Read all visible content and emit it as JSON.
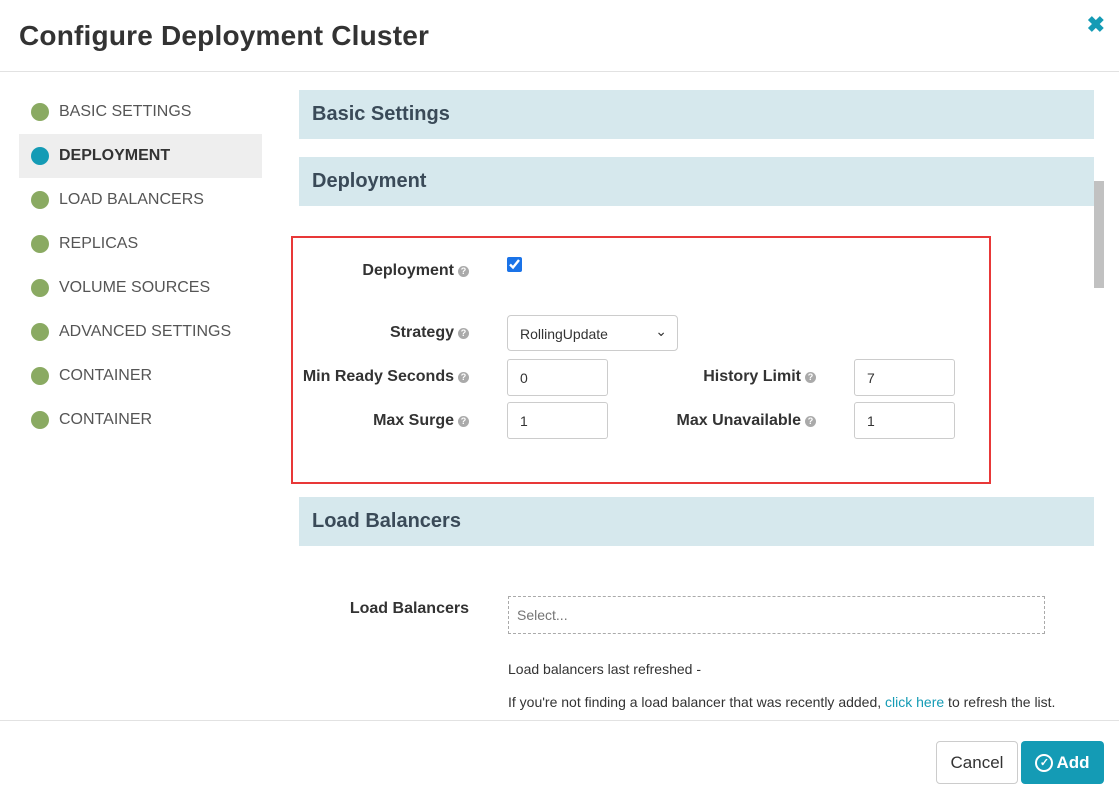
{
  "dialog": {
    "title": "Configure Deployment Cluster",
    "close_icon": "close-icon"
  },
  "sidebar": {
    "items": [
      {
        "label": "BASIC SETTINGS",
        "active": false
      },
      {
        "label": "DEPLOYMENT",
        "active": true
      },
      {
        "label": "LOAD BALANCERS",
        "active": false
      },
      {
        "label": "REPLICAS",
        "active": false
      },
      {
        "label": "VOLUME SOURCES",
        "active": false
      },
      {
        "label": "ADVANCED SETTINGS",
        "active": false
      },
      {
        "label": "CONTAINER",
        "active": false
      },
      {
        "label": "CONTAINER",
        "active": false
      }
    ]
  },
  "sections": {
    "basic": "Basic Settings",
    "deployment": "Deployment",
    "load_balancers": "Load Balancers"
  },
  "deployment": {
    "deployment_label": "Deployment",
    "deployment_checked": true,
    "strategy_label": "Strategy",
    "strategy_value": "RollingUpdate",
    "min_ready_label": "Min Ready Seconds",
    "min_ready_value": "0",
    "history_label": "History Limit",
    "history_value": "7",
    "max_surge_label": "Max Surge",
    "max_surge_value": "1",
    "max_unavail_label": "Max Unavailable",
    "max_unavail_value": "1"
  },
  "load_balancers": {
    "label": "Load Balancers",
    "placeholder": "Select...",
    "last_refreshed": "Load balancers last refreshed -",
    "hint_pre": "If you're not finding a load balancer that was recently added, ",
    "hint_link": "click here",
    "hint_post": " to refresh the list."
  },
  "footer": {
    "cancel": "Cancel",
    "add": "Add"
  },
  "colors": {
    "accent": "#149bb5",
    "complete": "#8aaa62",
    "highlight": "#e83838",
    "section_bg": "#d6e8ed"
  }
}
